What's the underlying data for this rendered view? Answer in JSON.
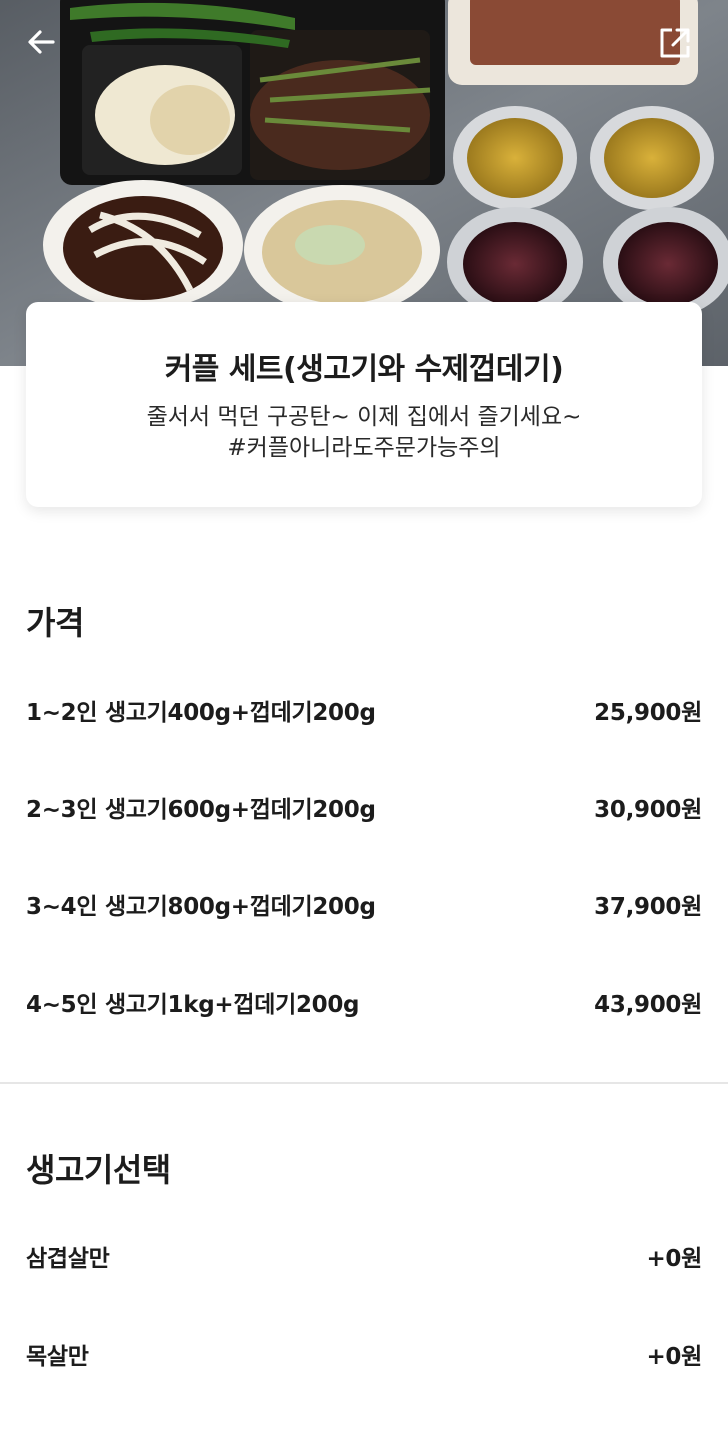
{
  "header": {
    "back_icon": "arrow-left-icon",
    "share_icon": "external-link-icon"
  },
  "product": {
    "title": "커플 세트(생고기와 수제껍데기)",
    "description_line1": "줄서서 먹던 구공탄~ 이제 집에서 즐기세요~",
    "description_line2": "#커플아니라도주문가능주의"
  },
  "price_section": {
    "title": "가격",
    "options": [
      {
        "label": "1~2인 생고기400g+껍데기200g",
        "price": "25,900원"
      },
      {
        "label": "2~3인 생고기600g+껍데기200g",
        "price": "30,900원"
      },
      {
        "label": "3~4인 생고기800g+껍데기200g",
        "price": "37,900원"
      },
      {
        "label": "4~5인 생고기1kg+껍데기200g",
        "price": "43,900원"
      }
    ]
  },
  "meat_section": {
    "title": "생고기선택",
    "options": [
      {
        "label": "삼겹살만",
        "price": "+0원"
      },
      {
        "label": "목살만",
        "price": "+0원"
      }
    ]
  },
  "colors": {
    "text": "#1c1c1c",
    "divider": "#e6e6e6",
    "card_bg": "#ffffff"
  }
}
